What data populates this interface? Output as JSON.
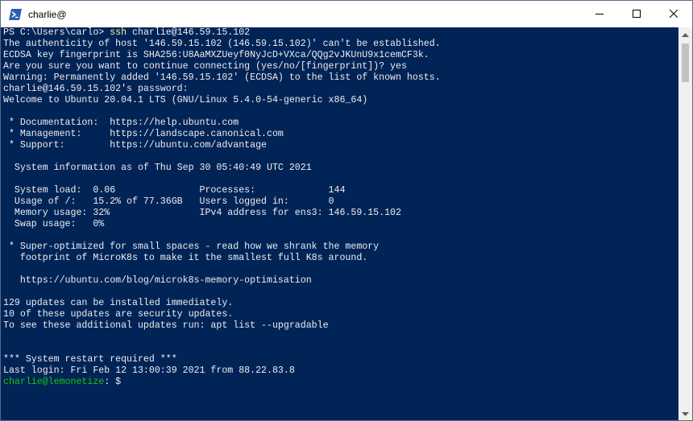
{
  "window": {
    "title": "charlie@"
  },
  "terminal": {
    "cmd_prompt": "PS C:\\Users\\carlo> ",
    "cmd_name": "ssh",
    "cmd_args": " charlie@146.59.15.102",
    "lines": [
      "The authenticity of host '146.59.15.102 (146.59.15.102)' can't be established.",
      "ECDSA key fingerprint is SHA256:U8AaMXZUeyf0NyJcD+VXca/QQg2vJKUnU9x1cemCF3k.",
      "Are you sure you want to continue connecting (yes/no/[fingerprint])? yes",
      "Warning: Permanently added '146.59.15.102' (ECDSA) to the list of known hosts.",
      "charlie@146.59.15.102's password:",
      "Welcome to Ubuntu 20.04.1 LTS (GNU/Linux 5.4.0-54-generic x86_64)",
      "",
      " * Documentation:  https://help.ubuntu.com",
      " * Management:     https://landscape.canonical.com",
      " * Support:        https://ubuntu.com/advantage",
      "",
      "  System information as of Thu Sep 30 05:40:49 UTC 2021",
      "",
      "  System load:  0.06               Processes:             144",
      "  Usage of /:   15.2% of 77.36GB   Users logged in:       0",
      "  Memory usage: 32%                IPv4 address for ens3: 146.59.15.102",
      "  Swap usage:   0%",
      "",
      " * Super-optimized for small spaces - read how we shrank the memory",
      "   footprint of MicroK8s to make it the smallest full K8s around.",
      "",
      "   https://ubuntu.com/blog/microk8s-memory-optimisation",
      "",
      "129 updates can be installed immediately.",
      "10 of these updates are security updates.",
      "To see these additional updates run: apt list --upgradable",
      "",
      "",
      "*** System restart required ***",
      "Last login: Fri Feb 12 13:00:39 2021 from 88.22.83.8"
    ],
    "final_prompt_user": "charlie@lemonetize",
    "final_prompt_suffix": ": $"
  },
  "colors": {
    "background": "#012456",
    "foreground": "#eeedf0",
    "command": "#f9f1a5",
    "prompt_user": "#16c60c"
  },
  "icons": {
    "app": "powershell-icon",
    "minimize": "minimize-icon",
    "maximize": "maximize-icon",
    "close": "close-icon",
    "scroll_up": "scroll-up-arrow-icon",
    "scroll_down": "scroll-down-arrow-icon"
  }
}
